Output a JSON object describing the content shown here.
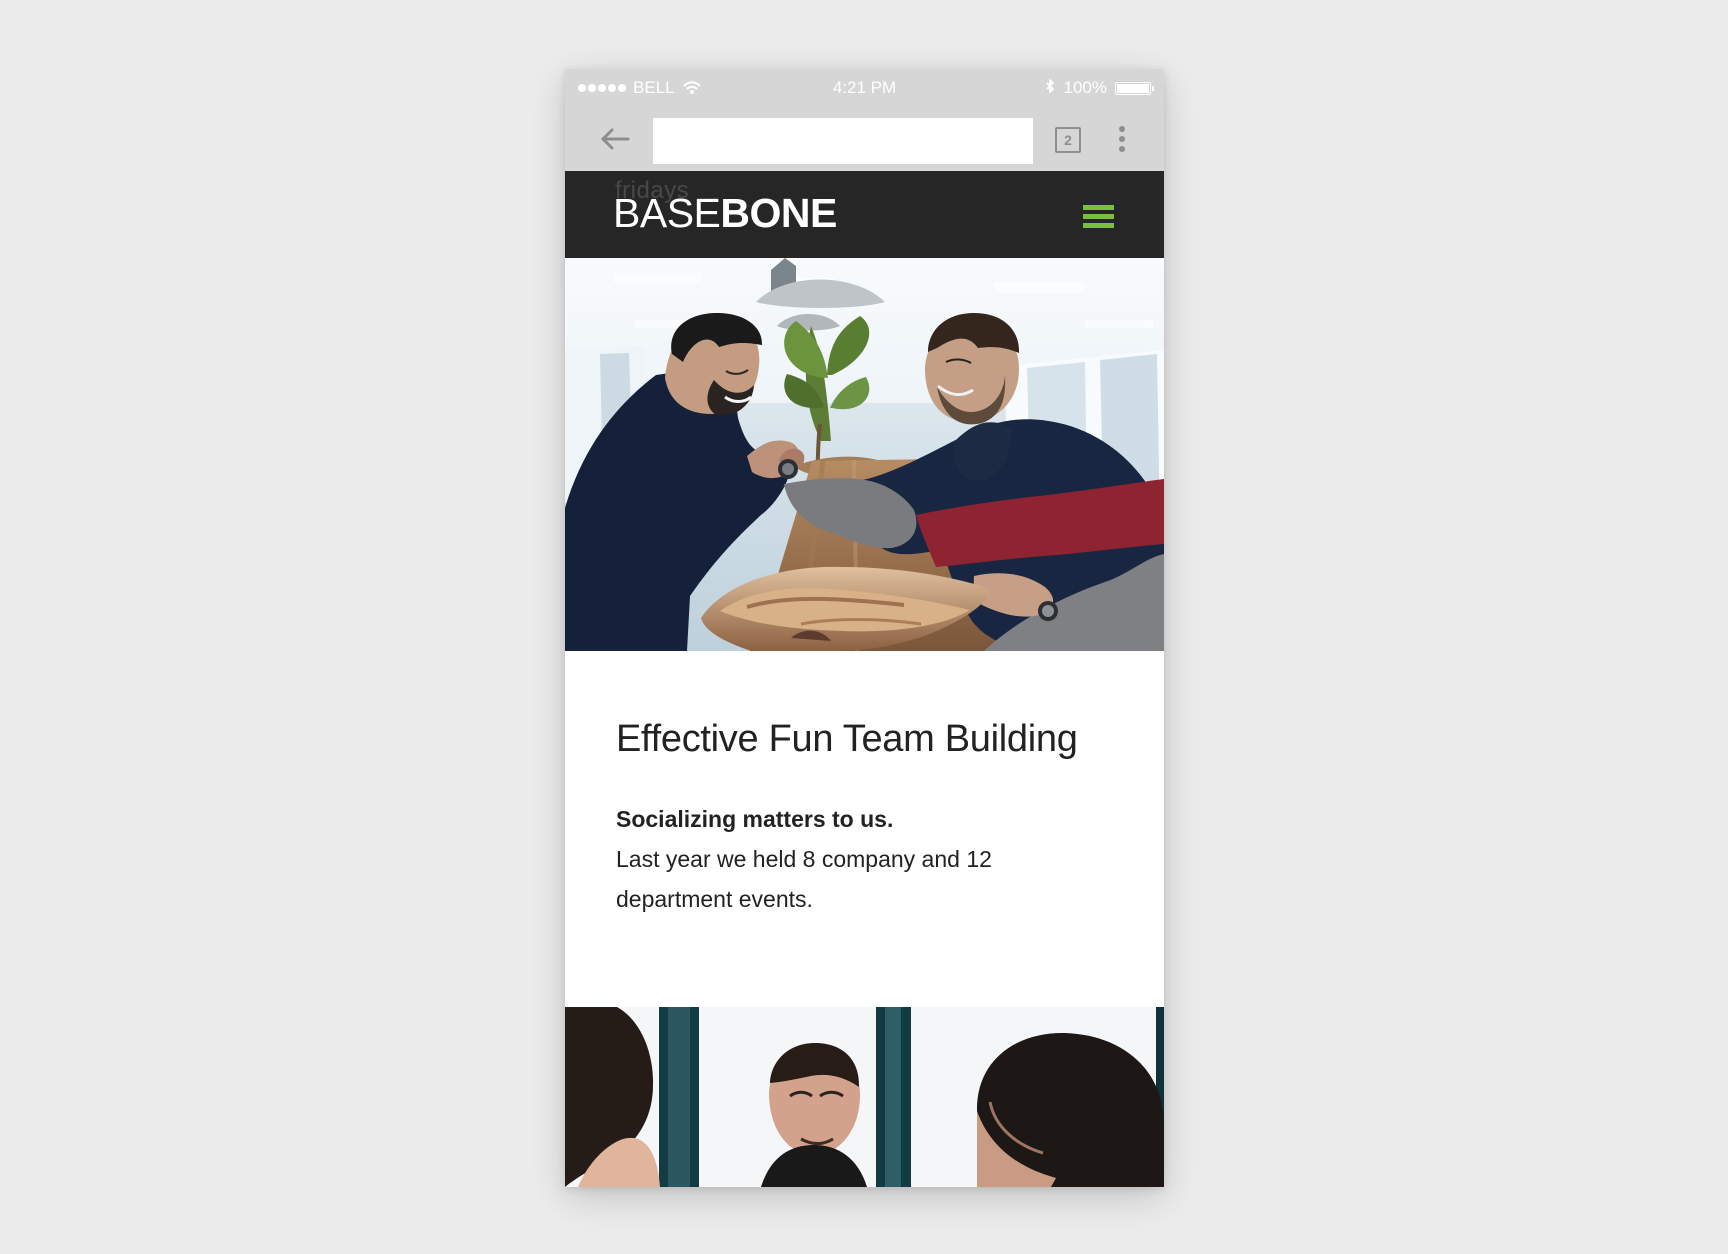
{
  "status_bar": {
    "carrier": "BELL",
    "time": "4:21 PM",
    "battery_level": "100%",
    "icons": [
      "signal-icon",
      "wifi-icon",
      "bluetooth-icon",
      "battery-icon"
    ]
  },
  "browser": {
    "url_value": "",
    "url_placeholder": "",
    "tab_count": "2",
    "icons": [
      "back-arrow-icon",
      "tabs-icon",
      "more-vertical-icon"
    ]
  },
  "header": {
    "ghost_text": "fridays",
    "logo_light": "BASE",
    "logo_bold": "BONE",
    "menu_icon": "hamburger-menu-icon",
    "accent_color": "#7bbf3f"
  },
  "hero": {
    "image": "two men arm wrestling at office table"
  },
  "content": {
    "heading": "Effective Fun Team Building",
    "strong_text": "Socializing matters to us.",
    "body_text": "Last year we held 8 company and 12 department events."
  },
  "bottom_image": {
    "image": "office meeting photo"
  },
  "colors": {
    "page_background": "#ececec",
    "browser_chrome": "#d6d6d6",
    "header_background": "#262626",
    "body_text": "#222222"
  }
}
